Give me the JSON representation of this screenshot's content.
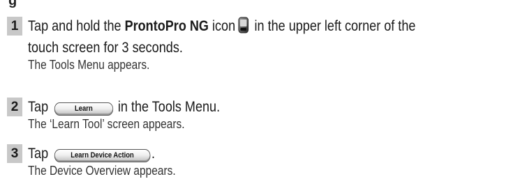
{
  "heading_fragment": "g",
  "steps": [
    {
      "number": "1",
      "text_before": "Tap and hold the ",
      "bold": "ProntoPro NG",
      "text_after_bold": " icon",
      "text_after_icon": " in the upper left corner of the",
      "text_line2": "touch screen for 3 seconds.",
      "result": "The Tools Menu appears.",
      "icon": "device-icon"
    },
    {
      "number": "2",
      "text_before": "Tap",
      "button_label": "Learn",
      "text_after": "in the Tools Menu.",
      "result": "The ‘Learn Tool’ screen appears."
    },
    {
      "number": "3",
      "text_before": "Tap",
      "button_label": "Learn Device Action",
      "text_after": ".",
      "result": "The Device Overview appears."
    }
  ]
}
